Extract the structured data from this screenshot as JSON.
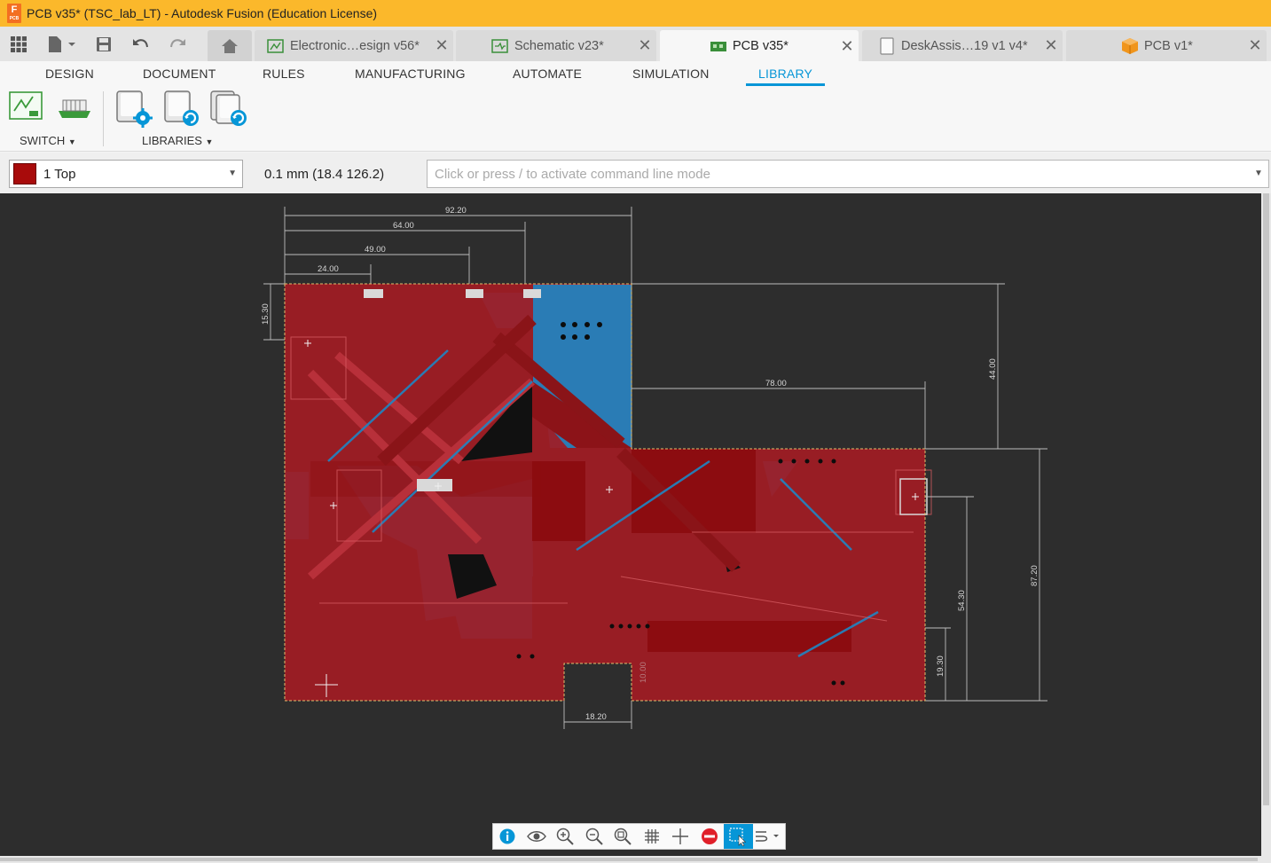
{
  "app": {
    "title": "PCB v35* (TSC_lab_LT) - Autodesk Fusion (Education License)",
    "icon_letter": "F",
    "icon_sub": "PCB"
  },
  "doc_tabs": [
    {
      "label": "Electronic…esign v56*",
      "icon": "electronics-design-icon",
      "active": false
    },
    {
      "label": "Schematic v23*",
      "icon": "schematic-icon",
      "active": false
    },
    {
      "label": "PCB v35*",
      "icon": "pcb-icon",
      "active": true
    },
    {
      "label": "DeskAssis…19 v1 v4*",
      "icon": "drawing-icon",
      "active": false
    },
    {
      "label": "PCB v1*",
      "icon": "3d-box-icon",
      "active": false
    }
  ],
  "ribbon": {
    "tabs": [
      "DESIGN",
      "DOCUMENT",
      "RULES",
      "MANUFACTURING",
      "AUTOMATE",
      "SIMULATION",
      "LIBRARY"
    ],
    "active_tab": "LIBRARY",
    "groups": {
      "switch": "SWITCH",
      "libraries": "LIBRARIES"
    }
  },
  "command_bar": {
    "layer": "1 Top",
    "layer_color": "#a80b0b",
    "coordinates": "0.1 mm (18.4 126.2)",
    "placeholder": "Click or press / to activate command line mode"
  },
  "board": {
    "dimensions": {
      "d9220": "92.20",
      "d6400": "64.00",
      "d4900": "49.00",
      "d2400": "24.00",
      "d1530": "15.30",
      "d4400": "44.00",
      "d7800": "78.00",
      "d8720": "87.20",
      "d5430": "54.30",
      "d1930": "19.30",
      "d1820": "18.20",
      "d1000": "10.00"
    },
    "copper_color": "#a01c24",
    "bottom_color": "#1e86c4"
  },
  "nav_tools": [
    "info-icon",
    "view-icon",
    "zoom-in-icon",
    "zoom-out-icon",
    "zoom-fit-icon",
    "grid-icon",
    "crosshair-icon",
    "stop-icon",
    "select-icon",
    "route-icon"
  ]
}
